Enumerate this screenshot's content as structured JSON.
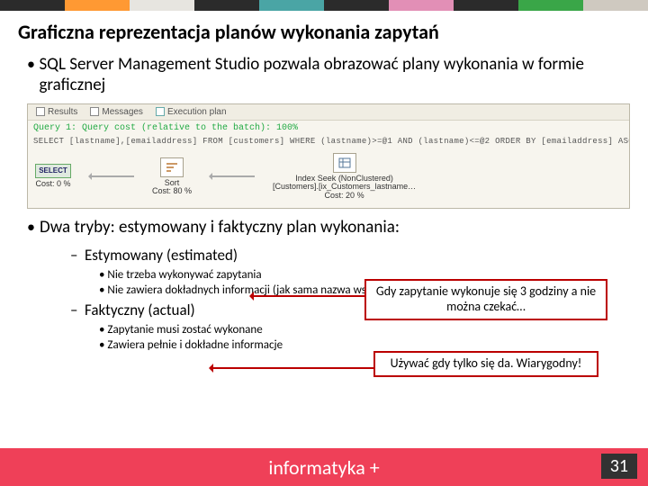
{
  "title": "Graficzna reprezentacja planów wykonania zapytań",
  "bullets": {
    "intro": "SQL Server Management Studio pozwala obrazować plany wykonania w formie graficznej",
    "modes": "Dwa tryby: estymowany i faktyczny plan wykonania:"
  },
  "ssms": {
    "tabs": {
      "results": "Results",
      "messages": "Messages",
      "plan": "Execution plan"
    },
    "query_line": "Query 1: Query cost (relative to the batch): 100%",
    "sql": "SELECT [lastname],[emailaddress] FROM [customers] WHERE (lastname)>=@1 AND (lastname)<=@2 ORDER BY [emailaddress] ASC",
    "ops": {
      "select": {
        "label": "SELECT",
        "cost": "Cost: 0 %"
      },
      "sort": {
        "label": "Sort",
        "cost": "Cost: 80 %"
      },
      "seek": {
        "label": "Index Seek (NonClustered)",
        "detail": "[Customers].[ix_Customers_lastname…",
        "cost": "Cost: 20 %"
      }
    }
  },
  "estimated": {
    "title": "Estymowany (estimated)",
    "p1": "Nie trzeba wykonywać zapytania",
    "p2": "Nie zawiera dokładnych informacji (jak sama nazwa wskazuje)"
  },
  "actual": {
    "title": "Faktyczny (actual)",
    "p1": "Zapytanie musi zostać wykonane",
    "p2": "Zawiera pełnie i dokładne informacje"
  },
  "callouts": {
    "est": "Gdy zapytanie wykonuje się 3 godziny a nie można czekać…",
    "act": "Używać gdy tylko się da. Wiarygodny!"
  },
  "footer": {
    "brand": "informatyka +",
    "page": "31"
  }
}
